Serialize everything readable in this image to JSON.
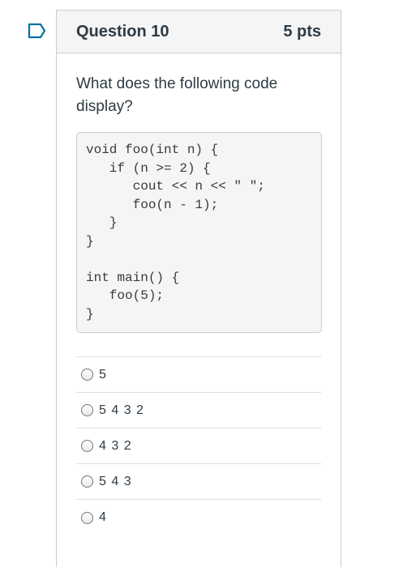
{
  "question": {
    "title": "Question 10",
    "points": "5 pts",
    "prompt": "What does the following code display?",
    "flag_icon": "flag-outline-icon",
    "code_lines": [
      "void foo(int n) {",
      "   if (n >= 2) {",
      "      cout << n << \" \";",
      "      foo(n - 1);",
      "   }",
      "}",
      "",
      "int main() {",
      "   foo(5);",
      "}"
    ],
    "answers": [
      {
        "label": "5"
      },
      {
        "label": "5 4 3 2"
      },
      {
        "label": "4 3 2"
      },
      {
        "label": "5 4 3"
      },
      {
        "label": "4"
      }
    ]
  },
  "colors": {
    "accent": "#0770a3",
    "header_bg": "#f5f5f5",
    "border": "#c7cdd1",
    "text": "#2d3b45"
  }
}
